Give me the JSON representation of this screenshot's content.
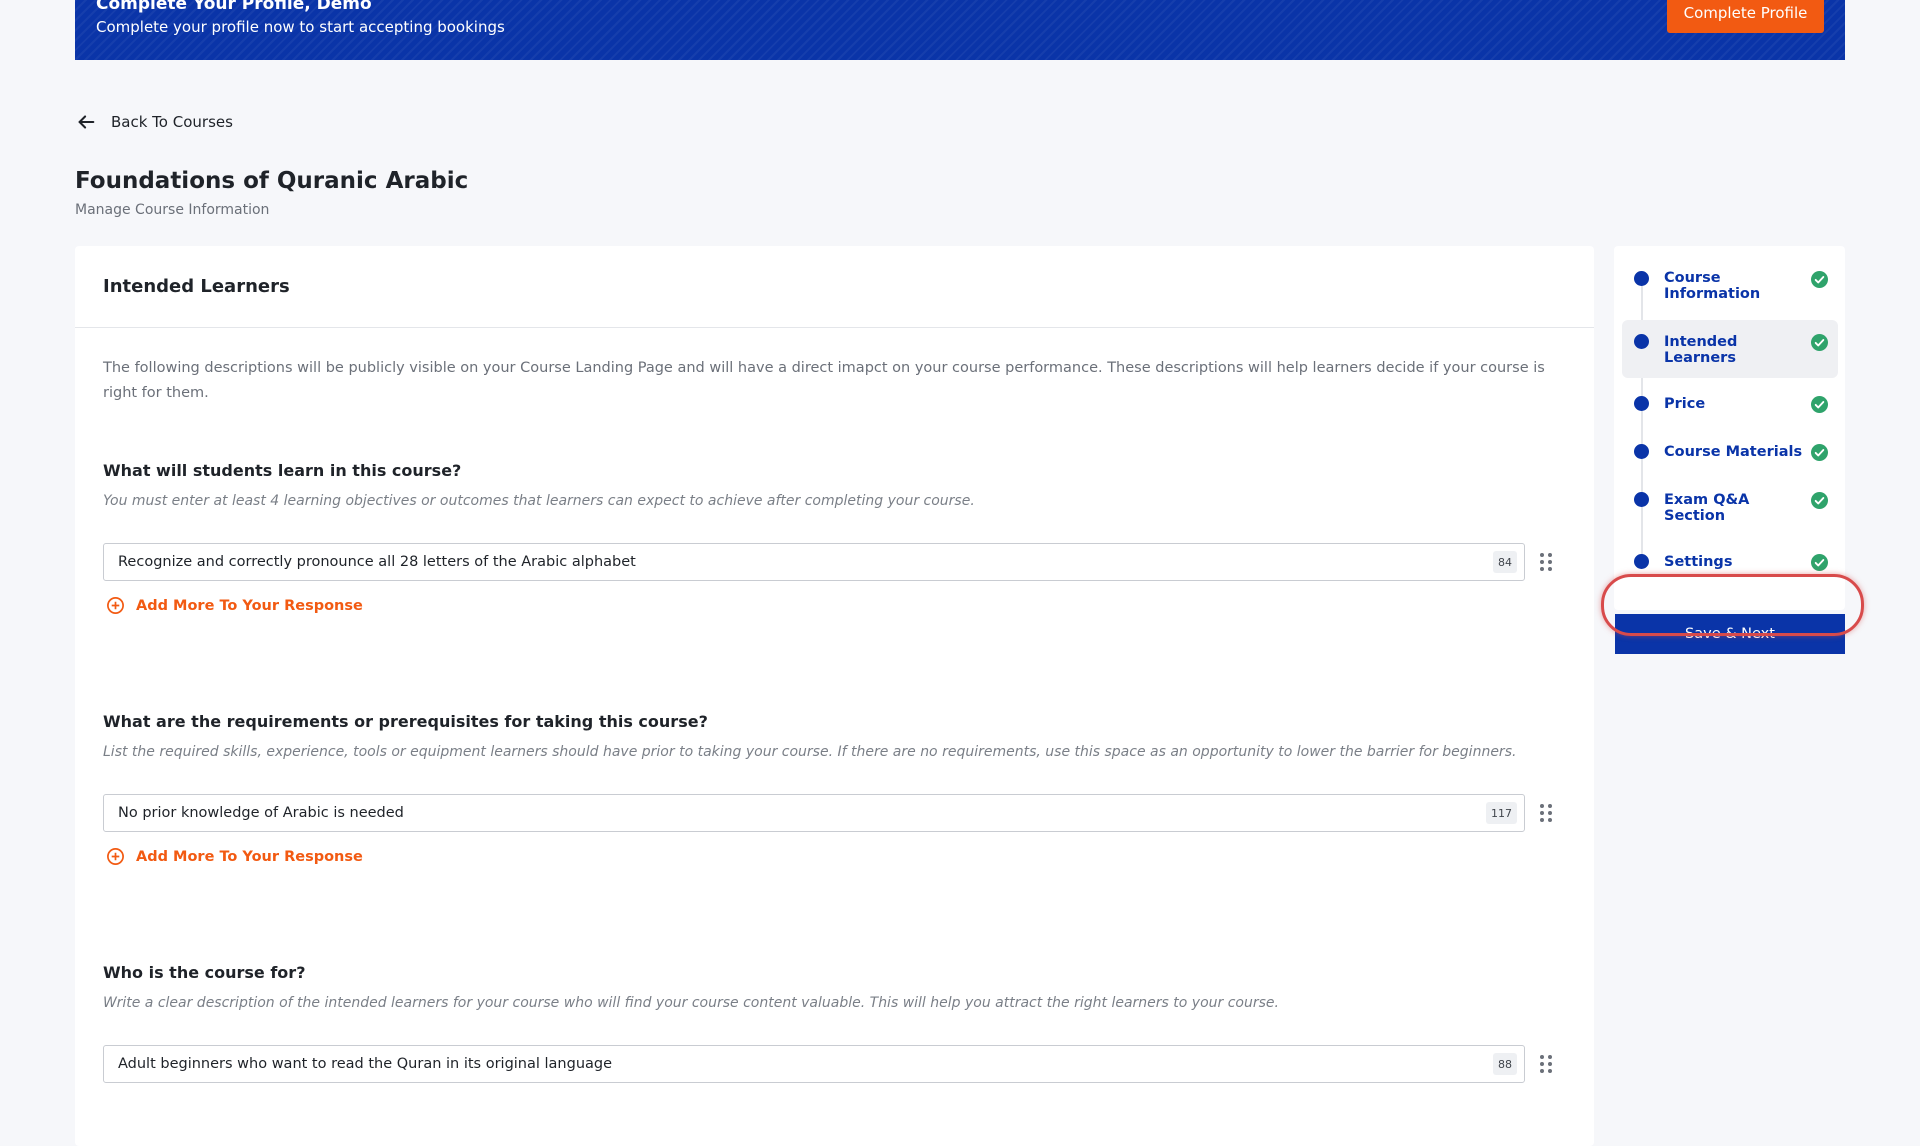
{
  "banner": {
    "title": "Complete Your Profile, Demo",
    "subtitle": "Complete your profile now to start accepting bookings",
    "button_label": "Complete Profile"
  },
  "back_link": {
    "label": "Back To Courses"
  },
  "page": {
    "title": "Foundations of Quranic Arabic",
    "subtitle": "Manage Course Information"
  },
  "card": {
    "header": "Intended Learners",
    "intro": "The following descriptions will be publicly visible on your Course Landing Page and will have a direct imapct on your course performance. These descriptions will help learners decide if your course is right for them."
  },
  "sections": [
    {
      "title": "What will students learn in this course?",
      "hint": "You must enter at least 4 learning objectives or outcomes that learners can expect to achieve after completing your course.",
      "value": "Recognize and correctly pronounce all 28 letters of the Arabic alphabet",
      "count": "84",
      "add_label": "Add More To Your Response"
    },
    {
      "title": "What are the requirements or prerequisites for taking this course?",
      "hint": "List the required skills, experience, tools or equipment learners should have prior to taking your course. If there are no requirements, use this space as an opportunity to lower the barrier for beginners.",
      "value": "No prior knowledge of Arabic is needed",
      "count": "117",
      "add_label": "Add More To Your Response"
    },
    {
      "title": "Who is the course for?",
      "hint": "Write a clear description of the intended learners for your course who will find your course content valuable. This will help you attract the right learners to your course.",
      "value": "Adult beginners who want to read the Quran in its original language",
      "count": "88"
    }
  ],
  "steps": [
    {
      "label": "Course Information",
      "completed": true
    },
    {
      "label": "Intended Learners",
      "completed": true,
      "active": true
    },
    {
      "label": "Price",
      "completed": true
    },
    {
      "label": "Course Materials",
      "completed": true
    },
    {
      "label": "Exam Q&A Section",
      "completed": true
    },
    {
      "label": "Settings",
      "completed": true
    }
  ],
  "save_button": {
    "label": "Save & Next"
  },
  "colors": {
    "brand_blue": "#0a34a8",
    "accent_orange": "#f25a12",
    "check_green": "#2fa36b",
    "highlight_red": "#d84b4b"
  }
}
